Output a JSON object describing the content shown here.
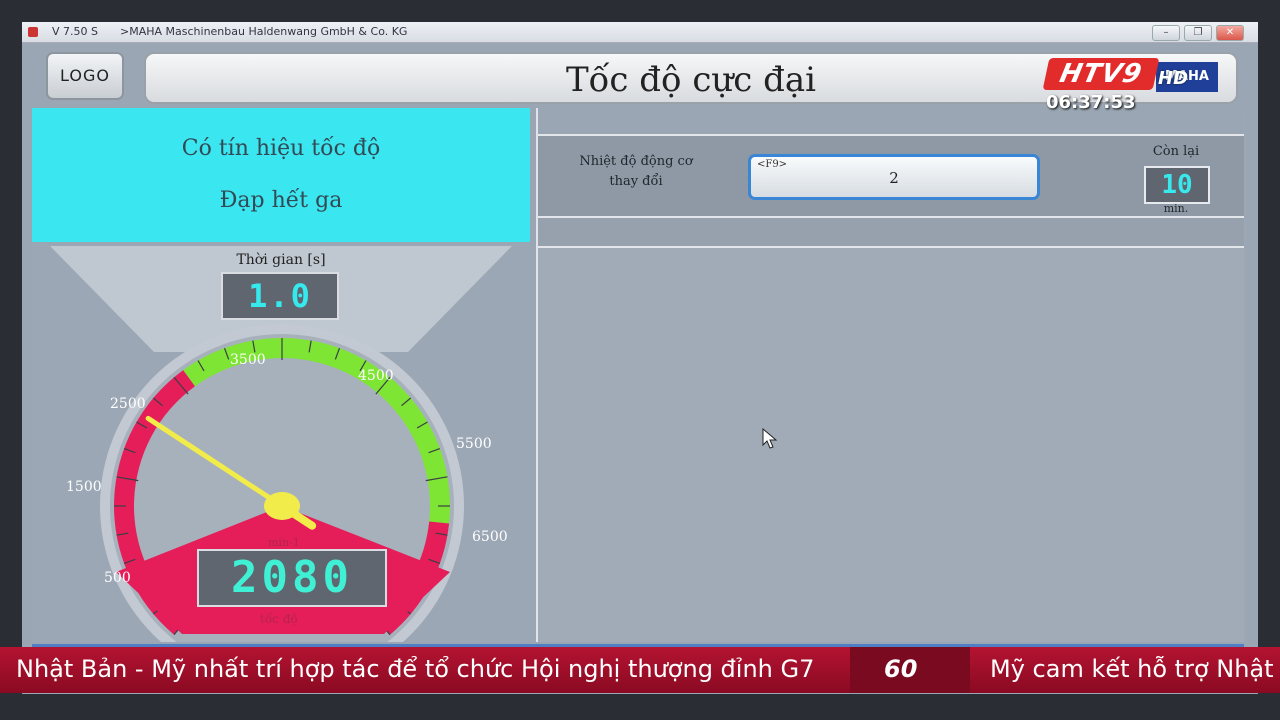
{
  "window": {
    "version": "V 7.50 S",
    "company": ">MAHA Maschinenbau Haldenwang GmbH & Co. KG",
    "buttons": [
      "minimize",
      "restore",
      "close"
    ]
  },
  "header": {
    "logo_label": "LOGO",
    "title": "Tốc độ cực đại",
    "brand_logo": "MAHA"
  },
  "status": {
    "line1": "Có tín hiệu tốc độ",
    "line2": "Đạp hết ga"
  },
  "timer": {
    "label": "Thời gian [s]",
    "value": "1.0"
  },
  "gauge": {
    "ticks": [
      "500",
      "1500",
      "2500",
      "3500",
      "4500",
      "5500",
      "6500"
    ],
    "value": 2080,
    "display": "2080",
    "unit": "min-1",
    "label": "tốc độ",
    "min": 0,
    "max": 7000,
    "green_range": [
      2600,
      5900
    ],
    "colors": {
      "red": "#e51e5a",
      "green": "#7ee534",
      "needle": "#f2ec4a"
    }
  },
  "engine": {
    "temp_label_1": "Nhiệt độ động cơ",
    "temp_label_2": "thay đổi",
    "temp_key": "<F9>",
    "temp_value": "2",
    "remaining_label": "Còn lại",
    "remaining_value": "10",
    "remaining_unit": "min."
  },
  "broadcast": {
    "channel": "HTV9",
    "hd": "HD",
    "clock": "06:37:53",
    "ticker_left": "Nhật Bản - Mỹ nhất trí hợp tác để tổ chức Hội nghị thượng đỉnh G7",
    "ticker_mark": "60",
    "ticker_right": "Mỹ cam kết hỗ trợ Nhật"
  }
}
